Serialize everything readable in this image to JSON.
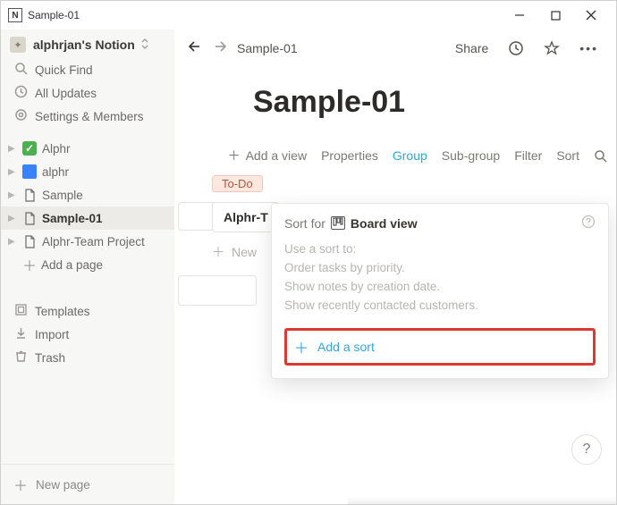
{
  "window": {
    "title": "Sample-01"
  },
  "workspace": {
    "name": "alphrjan's Notion"
  },
  "sidebar": {
    "quick_find": "Quick Find",
    "all_updates": "All Updates",
    "settings": "Settings & Members",
    "pages": [
      {
        "label": "Alphr"
      },
      {
        "label": "alphr"
      },
      {
        "label": "Sample"
      },
      {
        "label": "Sample-01"
      },
      {
        "label": "Alphr-Team Project"
      }
    ],
    "add_page": "Add a page",
    "templates": "Templates",
    "import": "Import",
    "trash": "Trash",
    "new_page": "New page"
  },
  "topbar": {
    "breadcrumb": "Sample-01",
    "share": "Share"
  },
  "page": {
    "title": "Sample-01"
  },
  "db_toolbar": {
    "add_view": "Add a view",
    "properties": "Properties",
    "group": "Group",
    "subgroup": "Sub-group",
    "filter": "Filter",
    "sort": "Sort"
  },
  "board": {
    "todo_tag": "To-Do",
    "card_label": "Alphr-T",
    "new_label": "New"
  },
  "popover": {
    "sort_for": "Sort for",
    "view_name": "Board view",
    "hint1": "Use a sort to:",
    "hint2": "Order tasks by priority.",
    "hint3": "Show notes by creation date.",
    "hint4": "Show recently contacted customers.",
    "add_sort": "Add a sort"
  }
}
